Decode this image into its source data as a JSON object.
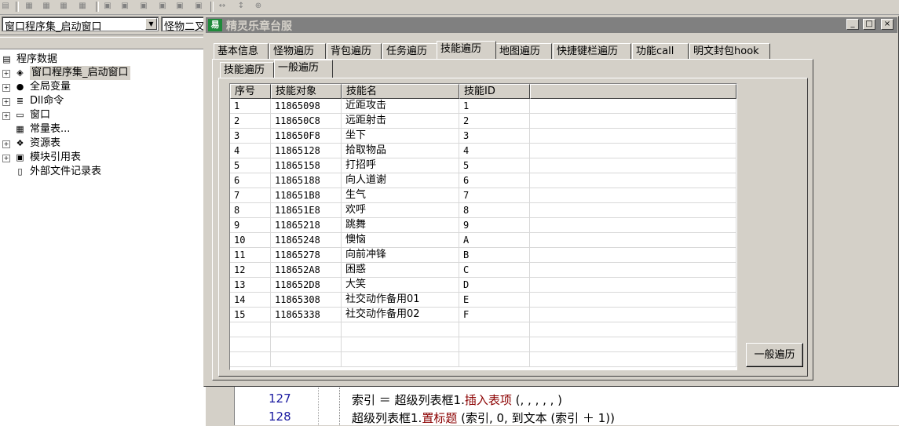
{
  "ide": {
    "combo_left": "窗口程序集_启动窗口",
    "combo_right": "怪物二叉"
  },
  "tree": {
    "root": "程序数据",
    "items": [
      {
        "label": "窗口程序集_启动窗口",
        "icon": "module-icon"
      },
      {
        "label": "全局变量",
        "icon": "variable-icon"
      },
      {
        "label": "Dll命令",
        "icon": "dll-icon"
      },
      {
        "label": "窗口",
        "icon": "window-icon"
      },
      {
        "label": "常量表...",
        "icon": "constant-icon"
      },
      {
        "label": "资源表",
        "icon": "resource-icon"
      },
      {
        "label": "模块引用表",
        "icon": "module-ref-icon"
      },
      {
        "label": "外部文件记录表",
        "icon": "file-icon"
      }
    ]
  },
  "code": {
    "lines": [
      {
        "num": "127",
        "pre": "索引 ＝ 超级列表框1.",
        "method": "插入表项",
        "post": " (, , , , , )"
      },
      {
        "num": "128",
        "pre": "超级列表框1.",
        "method": "置标题",
        "post": " (索引, 0, 到文本 (索引 ＋ 1))"
      }
    ]
  },
  "window": {
    "title": "精灵乐章台服",
    "app_icon_glyph": "易",
    "min_glyph": "_",
    "max_glyph": "□",
    "close_glyph": "×"
  },
  "tabs": {
    "main": [
      "基本信息",
      "怪物遍历",
      "背包遍历",
      "任务遍历",
      "技能遍历",
      "地图遍历",
      "快捷键栏遍历",
      "功能call",
      "明文封包hook"
    ],
    "active_main": 4,
    "sub": [
      "技能遍历",
      "一般遍历"
    ],
    "active_sub": 1
  },
  "list": {
    "columns": [
      "序号",
      "技能对象",
      "技能名",
      "技能ID"
    ],
    "rows": [
      [
        "1",
        "11865098",
        "近距攻击",
        "1"
      ],
      [
        "2",
        "118650C8",
        "远距射击",
        "2"
      ],
      [
        "3",
        "118650F8",
        "坐下",
        "3"
      ],
      [
        "4",
        "11865128",
        "拾取物品",
        "4"
      ],
      [
        "5",
        "11865158",
        "打招呼",
        "5"
      ],
      [
        "6",
        "11865188",
        "向人道谢",
        "6"
      ],
      [
        "7",
        "118651B8",
        "生气",
        "7"
      ],
      [
        "8",
        "118651E8",
        "欢呼",
        "8"
      ],
      [
        "9",
        "11865218",
        "跳舞",
        "9"
      ],
      [
        "10",
        "11865248",
        "懊恼",
        "A"
      ],
      [
        "11",
        "11865278",
        "向前冲锋",
        "B"
      ],
      [
        "12",
        "118652A8",
        "困惑",
        "C"
      ],
      [
        "13",
        "118652D8",
        "大笑",
        "D"
      ],
      [
        "14",
        "11865308",
        "社交动作备用01",
        "E"
      ],
      [
        "15",
        "11865338",
        "社交动作备用02",
        "F"
      ]
    ]
  },
  "button": {
    "traverse": "一般遍历"
  }
}
